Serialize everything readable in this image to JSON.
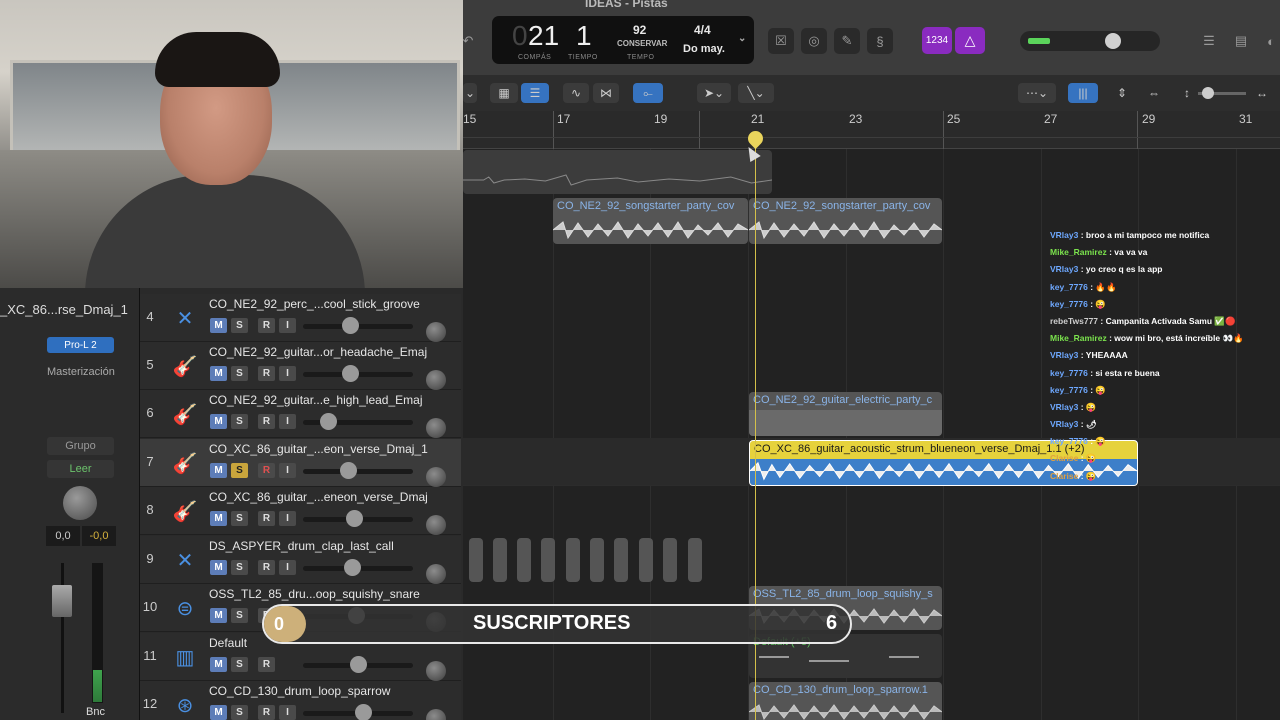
{
  "window": {
    "title": "IDEAS - Pistas"
  },
  "lcd": {
    "bar": "21",
    "beat": "1",
    "bar_label": "COMPÁS",
    "beat_label": "TIEMPO",
    "tempo": "92",
    "tempo_mode": "CONSERVAR",
    "tempo_label": "TEMPO",
    "signature": "4/4",
    "key": "Do may."
  },
  "toolbar": {
    "count_in_label": "1234"
  },
  "ruler": {
    "bars": [
      "15",
      "17",
      "19",
      "21",
      "23",
      "25",
      "27",
      "29",
      "31"
    ]
  },
  "inspector": {
    "track_name": "_XC_86...rse_Dmaj_1",
    "plugin": "Pro-L 2",
    "plugin_group": "Masterización",
    "group_label": "Grupo",
    "automation_mode": "Leer",
    "volume": "0,0",
    "pan": "-0,0",
    "bounce_label": "Bnc"
  },
  "tracks": [
    {
      "num": "4",
      "name": "CO_NE2_92_perc_...cool_stick_groove",
      "icon": "drumsticks-icon",
      "mute_label": "M",
      "solo_label": "S",
      "rec_label": "R",
      "input_label": "I"
    },
    {
      "num": "5",
      "name": "CO_NE2_92_guitar...or_headache_Emaj",
      "icon": "guitar-icon",
      "mute_label": "M",
      "solo_label": "S",
      "rec_label": "R",
      "input_label": "I"
    },
    {
      "num": "6",
      "name": "CO_NE2_92_guitar...e_high_lead_Emaj",
      "icon": "guitar-icon",
      "mute_label": "M",
      "solo_label": "S",
      "rec_label": "R",
      "input_label": "I"
    },
    {
      "num": "7",
      "name": "CO_XC_86_guitar_...eon_verse_Dmaj_1",
      "icon": "guitar-icon",
      "mute_label": "M",
      "solo_label": "S",
      "rec_label": "R",
      "input_label": "I"
    },
    {
      "num": "8",
      "name": "CO_XC_86_guitar_...eneon_verse_Dmaj",
      "icon": "guitar-icon",
      "mute_label": "M",
      "solo_label": "S",
      "rec_label": "R",
      "input_label": "I"
    },
    {
      "num": "9",
      "name": "DS_ASPYER_drum_clap_last_call",
      "icon": "drumsticks-icon",
      "mute_label": "M",
      "solo_label": "S",
      "rec_label": "R",
      "input_label": "I"
    },
    {
      "num": "10",
      "name": "OSS_TL2_85_dru...oop_squishy_snare",
      "icon": "snare-drum-icon",
      "mute_label": "M",
      "solo_label": "S",
      "rec_label": "R",
      "input_label": "I"
    },
    {
      "num": "11",
      "name": "Default",
      "icon": "keyboard-icon",
      "mute_label": "M",
      "solo_label": "S",
      "rec_label": "R",
      "input_label": ""
    },
    {
      "num": "12",
      "name": "CO_CD_130_drum_loop_sparrow",
      "icon": "drum-kit-icon",
      "mute_label": "M",
      "solo_label": "S",
      "rec_label": "R",
      "input_label": "I"
    }
  ],
  "regions": {
    "r1": "CO_NE2_92_songstarter_party_cov",
    "r2": "CO_NE2_92_songstarter_party_cov",
    "r3": "CO_NE2_92_guitar_electric_party_c",
    "r4": "CO_XC_86_guitar_acoustic_strum_blueneon_verse_Dmaj_1.1 (+2)",
    "r5": "OSS_TL2_85_drum_loop_squishy_s",
    "r6": "Default (+5)",
    "r7": "CO_CD_130_drum_loop_sparrow.1"
  },
  "chat": [
    {
      "user": "VRlay3",
      "color": "#6ea8ff",
      "text": ": broo a mi tampoco me notifica"
    },
    {
      "user": "Mike_Ramirez",
      "color": "#7be34d",
      "text": ": va va va"
    },
    {
      "user": "VRlay3",
      "color": "#6ea8ff",
      "text": ": yo creo q es la app"
    },
    {
      "user": "key_7776",
      "color": "#6ea8ff",
      "text": ": 🔥🔥"
    },
    {
      "user": "key_7776",
      "color": "#6ea8ff",
      "text": ": 😜"
    },
    {
      "user": "rebeTws777",
      "color": "#cfcfcf",
      "text": ": Campanita Activada Samu ✅🔴"
    },
    {
      "user": "Mike_Ramirez",
      "color": "#7be34d",
      "text": ": wow mi bro, está increíble 👀🔥"
    },
    {
      "user": "VRlay3",
      "color": "#6ea8ff",
      "text": ": YHEAAAA"
    },
    {
      "user": "key_7776",
      "color": "#6ea8ff",
      "text": ": si esta re buena"
    },
    {
      "user": "key_7776",
      "color": "#6ea8ff",
      "text": ": 😜"
    },
    {
      "user": "VRlay3",
      "color": "#6ea8ff",
      "text": ": 😜"
    },
    {
      "user": "VRlay3",
      "color": "#6ea8ff",
      "text": ": 🌶"
    },
    {
      "user": "key_7776",
      "color": "#6ea8ff",
      "text": ": 😜"
    },
    {
      "user": "Clarise",
      "color": "#e0a040",
      "text": ": 😜"
    },
    {
      "user": "Clarise",
      "color": "#e0a040",
      "text": ": 😜"
    }
  ],
  "subscribers": {
    "current": "0",
    "label": "SUSCRIPTORES",
    "goal": "6",
    "progress": 0
  },
  "colors": {
    "accent": "#8a2bc0",
    "region_selected": "#e6d23c",
    "playhead": "#d4c04a",
    "mute": "#5d7db8"
  }
}
